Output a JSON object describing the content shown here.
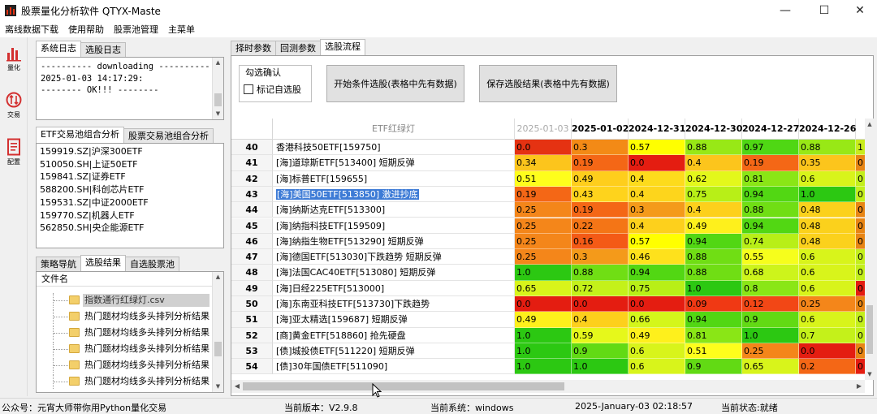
{
  "window": {
    "title": "股票量化分析软件 QTYX-Maste"
  },
  "menu": [
    "离线数据下载",
    "使用帮助",
    "股票池管理",
    "主菜单"
  ],
  "toolbar": [
    {
      "label": "量化",
      "icon": "bar-chart-icon",
      "color": "#d32f2f"
    },
    {
      "label": "交易",
      "icon": "trade-exchange-icon",
      "color": "#d32f2f"
    },
    {
      "label": "配置",
      "icon": "config-document-icon",
      "color": "#d32f2f"
    }
  ],
  "log_tabs": [
    "系统日志",
    "选股日志"
  ],
  "log_lines": [
    "---------- downloading ----------",
    "2025-01-03 14:17:29:",
    "-------- OK!!! --------"
  ],
  "etf_tabs": [
    "ETF交易池组合分析",
    "股票交易池组合分析"
  ],
  "etf_list": [
    "159919.SZ|沪深300ETF",
    "510050.SH|上证50ETF",
    "159841.SZ|证券ETF",
    "588200.SH|科创芯片ETF",
    "159531.SZ|中证2000ETF",
    "159770.SZ|机器人ETF",
    "562850.SH|央企能源ETF"
  ],
  "nav_tabs": [
    "策略导航",
    "选股结果",
    "自选股票池"
  ],
  "file_tree": {
    "header": "文件名",
    "items": [
      "指数通行红绿灯.csv",
      "热门题材均线多头排列分析结果",
      "热门题材均线多头排列分析结果",
      "热门题材均线多头排列分析结果",
      "热门题材均线多头排列分析结果",
      "热门题材均线多头排列分析结果"
    ]
  },
  "right_tabs": [
    "择时参数",
    "回测参数",
    "选股流程"
  ],
  "controls": {
    "group_label": "勾选确认",
    "checkbox_label": "标记自选股",
    "start_button": "开始条件选股(表格中先有数据)",
    "save_button": "保存选股结果(表格中先有数据)"
  },
  "table": {
    "name_header": "ETF红绿灯",
    "date_headers": [
      "2025-01-03",
      "2025-01-02",
      "2024-12-31",
      "2024-12-30",
      "2024-12-27",
      "2024-12-26",
      "2"
    ],
    "rows": [
      {
        "idx": "40",
        "name": "香港科技50ETF[159750]",
        "values": [
          "0.0",
          "0.3",
          "0.57",
          "0.88",
          "0.97",
          "0.88",
          "1"
        ],
        "colors": [
          "#e53212",
          "#f38a16",
          "#ffff00",
          "#98e816",
          "#4fd714",
          "#98e816",
          "#c9ec1c"
        ]
      },
      {
        "idx": "41",
        "name": "[海]道琼斯ETF[513400] 短期反弹",
        "values": [
          "0.34",
          "0.19",
          "0.0",
          "0.4",
          "0.19",
          "0.35",
          "0"
        ],
        "colors": [
          "#fcc51c",
          "#f46716",
          "#e41d11",
          "#fcc51c",
          "#f46716",
          "#fcc51c",
          "#e88514"
        ]
      },
      {
        "idx": "42",
        "name": "[海]标普ETF[159655]",
        "values": [
          "0.51",
          "0.49",
          "0.4",
          "0.62",
          "0.81",
          "0.6",
          "0"
        ],
        "colors": [
          "#fefe1c",
          "#fece1c",
          "#fddb1c",
          "#e3f81b",
          "#8ae616",
          "#d8f41b",
          "#c3ef1c"
        ]
      },
      {
        "idx": "43",
        "name": "[海]美国50ETF[513850] 激进抄底",
        "values": [
          "0.19",
          "0.43",
          "0.4",
          "0.75",
          "0.94",
          "1.0",
          "0"
        ],
        "colors": [
          "#f46716",
          "#fed31c",
          "#fdd51c",
          "#b8ef17",
          "#52d713",
          "#2cc812",
          "#c3ef1c"
        ]
      },
      {
        "idx": "44",
        "name": "[海]纳斯达克ETF[513300]",
        "values": [
          "0.25",
          "0.19",
          "0.3",
          "0.4",
          "0.88",
          "0.48",
          "0"
        ],
        "colors": [
          "#f4861a",
          "#f46716",
          "#f49a1a",
          "#fdd01c",
          "#70de14",
          "#fbd11c",
          "#e88514"
        ]
      },
      {
        "idx": "45",
        "name": "[海]纳指科技ETF[159509]",
        "values": [
          "0.25",
          "0.22",
          "0.4",
          "0.49",
          "0.94",
          "0.48",
          "0"
        ],
        "colors": [
          "#f4861a",
          "#f47516",
          "#fdd01c",
          "#fef01c",
          "#52d713",
          "#fbd11c",
          "#e88514"
        ]
      },
      {
        "idx": "46",
        "name": "[海]纳指生物ETF[513290] 短期反弹",
        "values": [
          "0.25",
          "0.16",
          "0.57",
          "0.94",
          "0.74",
          "0.48",
          "0"
        ],
        "colors": [
          "#f4861a",
          "#f45a16",
          "#ffff00",
          "#52d713",
          "#b8ef17",
          "#fbd11c",
          "#e88514"
        ]
      },
      {
        "idx": "47",
        "name": "[海]德国ETF[513030]下跌趋势 短期反弹",
        "values": [
          "0.25",
          "0.3",
          "0.46",
          "0.88",
          "0.55",
          "0.6",
          "0"
        ],
        "colors": [
          "#f4861a",
          "#f49a1a",
          "#fee11c",
          "#70de14",
          "#f6fe1c",
          "#d8f41b",
          "#c3ef1c"
        ]
      },
      {
        "idx": "48",
        "name": "[海]法国CAC40ETF[513080] 短期反弹",
        "values": [
          "1.0",
          "0.88",
          "0.94",
          "0.88",
          "0.68",
          "0.6",
          "0"
        ],
        "colors": [
          "#2cc812",
          "#70de14",
          "#52d713",
          "#70de14",
          "#cdf41b",
          "#d8f41b",
          "#c3ef1c"
        ]
      },
      {
        "idx": "49",
        "name": "[海]日经225ETF[513000]",
        "values": [
          "0.65",
          "0.72",
          "0.75",
          "1.0",
          "0.8",
          "0.6",
          "0"
        ],
        "colors": [
          "#d8f41b",
          "#c4f11a",
          "#b8ef17",
          "#2cc812",
          "#8ae616",
          "#d8f41b",
          "#e41d11"
        ]
      },
      {
        "idx": "50",
        "name": "[海]东南亚科技ETF[513730]下跌趋势",
        "values": [
          "0.0",
          "0.0",
          "0.0",
          "0.09",
          "0.12",
          "0.25",
          "0"
        ],
        "colors": [
          "#e41d11",
          "#e41d11",
          "#e41d11",
          "#f03914",
          "#f24716",
          "#f4861a",
          "#e88514"
        ]
      },
      {
        "idx": "51",
        "name": "[海]亚太精选[159687] 短期反弹",
        "values": [
          "0.49",
          "0.4",
          "0.66",
          "0.94",
          "0.9",
          "0.6",
          "0"
        ],
        "colors": [
          "#fef01c",
          "#fdd01c",
          "#d4f61b",
          "#52d713",
          "#62da14",
          "#d8f41b",
          "#c3ef1c"
        ]
      },
      {
        "idx": "52",
        "name": "[商]黄金ETF[518860] 抢先硬盘",
        "values": [
          "1.0",
          "0.59",
          "0.49",
          "0.81",
          "1.0",
          "0.7",
          "0"
        ],
        "colors": [
          "#2cc812",
          "#e6f81b",
          "#fef01c",
          "#8ae616",
          "#2cc812",
          "#c4f11a",
          "#c3ef1c"
        ]
      },
      {
        "idx": "53",
        "name": "[债]城投债ETF[511220] 短期反弹",
        "values": [
          "1.0",
          "0.9",
          "0.6",
          "0.51",
          "0.25",
          "0.0",
          "0"
        ],
        "colors": [
          "#2cc812",
          "#62da14",
          "#d8f41b",
          "#fefe1c",
          "#f4861a",
          "#e41d11",
          "#e88514"
        ]
      },
      {
        "idx": "54",
        "name": "[债]30年国债ETF[511090]",
        "values": [
          "1.0",
          "1.0",
          "0.6",
          "0.9",
          "0.65",
          "0.2",
          "0"
        ],
        "colors": [
          "#2cc812",
          "#2cc812",
          "#d8f41b",
          "#62da14",
          "#d8f41b",
          "#f46716",
          "#e41d11"
        ]
      }
    ]
  },
  "status_bar": {
    "account": "公众号：元宵大师带你用Python量化交易",
    "version": "当前版本：V2.9.8",
    "system": "当前系统：windows",
    "datetime": "2025-January-03 02:18:57",
    "state": "当前状态:就绪"
  }
}
